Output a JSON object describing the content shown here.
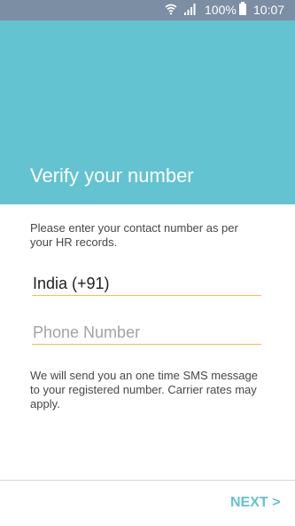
{
  "status_bar": {
    "battery_percent": "100%",
    "time": "10:07",
    "wifi_icon": "wifi-icon",
    "signal_icon": "signal-icon",
    "battery_icon": "battery-icon"
  },
  "header": {
    "title": "Verify your number",
    "background_color": "#63c3d0"
  },
  "content": {
    "intro_text": "Please enter your contact number as per your HR records.",
    "country_value": "India (+91)",
    "phone_placeholder": "Phone Number",
    "sms_note": "We will send you an one time SMS message to your registered number. Carrier rates may apply."
  },
  "footer": {
    "next_label": "NEXT >"
  },
  "colors": {
    "accent": "#63c3d0",
    "field_underline": "#f2c14e"
  }
}
